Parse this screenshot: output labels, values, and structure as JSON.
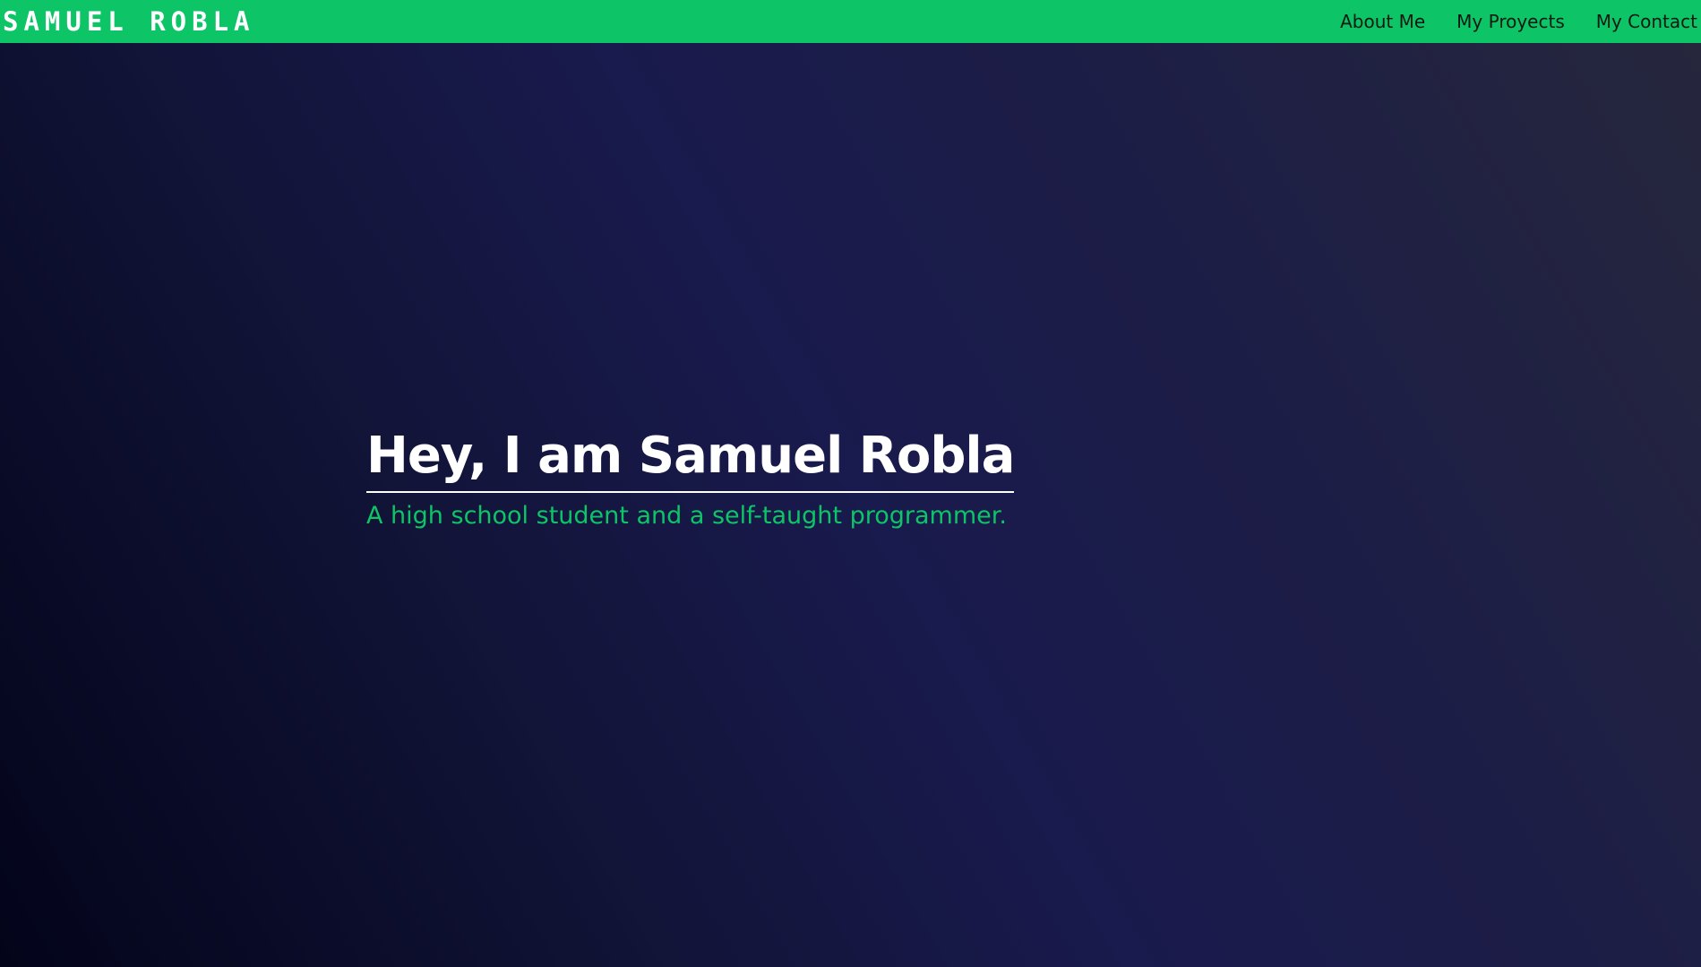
{
  "navbar": {
    "brand": "SAMUEL ROBLA",
    "links": [
      {
        "label": "About Me"
      },
      {
        "label": "My Proyects"
      },
      {
        "label": "My Contact"
      }
    ]
  },
  "hero": {
    "title": "Hey, I am Samuel Robla",
    "subtitle": "A high school student and a self-taught programmer."
  },
  "colors": {
    "accent": "#0dc466",
    "background_start": "#03041a",
    "background_mid": "#191a4d",
    "background_end": "#26273c"
  }
}
